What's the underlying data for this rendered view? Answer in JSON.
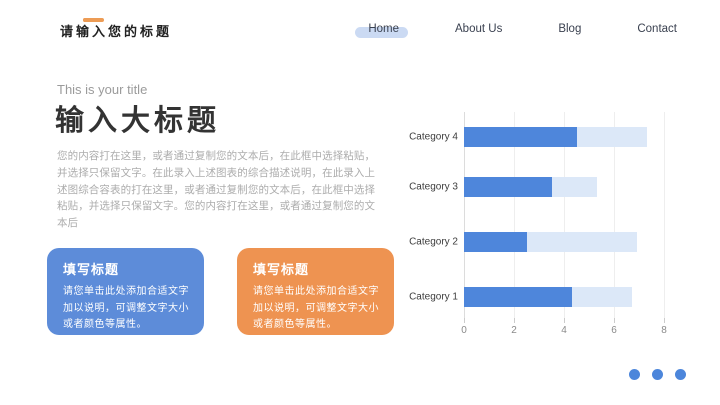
{
  "header": {
    "logo_icon": "menu-bars-icon",
    "brand_title": "请输入您的标题",
    "nav": [
      {
        "label": "Home",
        "active": true
      },
      {
        "label": "About Us",
        "active": false
      },
      {
        "label": "Blog",
        "active": false
      },
      {
        "label": "Contact",
        "active": false
      }
    ]
  },
  "content": {
    "subtitle": "This is your title",
    "title": "输入大标题",
    "paragraph": "您的内容打在这里，或者通过复制您的文本后，在此框中选择粘贴，并选择只保留文字。在此录入上述图表的综合描述说明，在此录入上述图综合容表的打在这里，或者通过复制您的文本后，在此框中选择粘贴，并选择只保留文字。您的内容打在这里，或者通过复制您的文本后",
    "cards": [
      {
        "title": "填写标题",
        "body": "请您单击此处添加合适文字加以说明，可调整文字大小或者颜色等属性。",
        "color": "#5d8cd9"
      },
      {
        "title": "填写标题",
        "body": "请您单击此处添加合适文字加以说明，可调整文字大小或者颜色等属性。",
        "color": "#ee9351"
      }
    ]
  },
  "chart_data": {
    "type": "bar",
    "orientation": "horizontal",
    "stacked": true,
    "categories": [
      "Category 1",
      "Category 2",
      "Category 3",
      "Category 4"
    ],
    "series": [
      {
        "name": "primary",
        "color": "#4e86db",
        "values": [
          4.3,
          2.5,
          3.5,
          4.5
        ]
      },
      {
        "name": "secondary",
        "color": "#dce8f8",
        "values": [
          2.4,
          4.4,
          1.8,
          2.8
        ]
      }
    ],
    "totals": [
      6.7,
      6.9,
      5.3,
      7.3
    ],
    "x_ticks": [
      0,
      2,
      4,
      6,
      8
    ],
    "xlim": [
      0,
      8
    ],
    "grid": true,
    "legend": false,
    "title": "",
    "xlabel": "",
    "ylabel": ""
  },
  "footer": {
    "dots_count": 3,
    "dot_color": "#4c86db"
  },
  "colors": {
    "accent_orange": "#ed9c55",
    "accent_blue": "#4e86db",
    "nav_active_pill": "#cbdaf3",
    "background": "#ffffff"
  }
}
